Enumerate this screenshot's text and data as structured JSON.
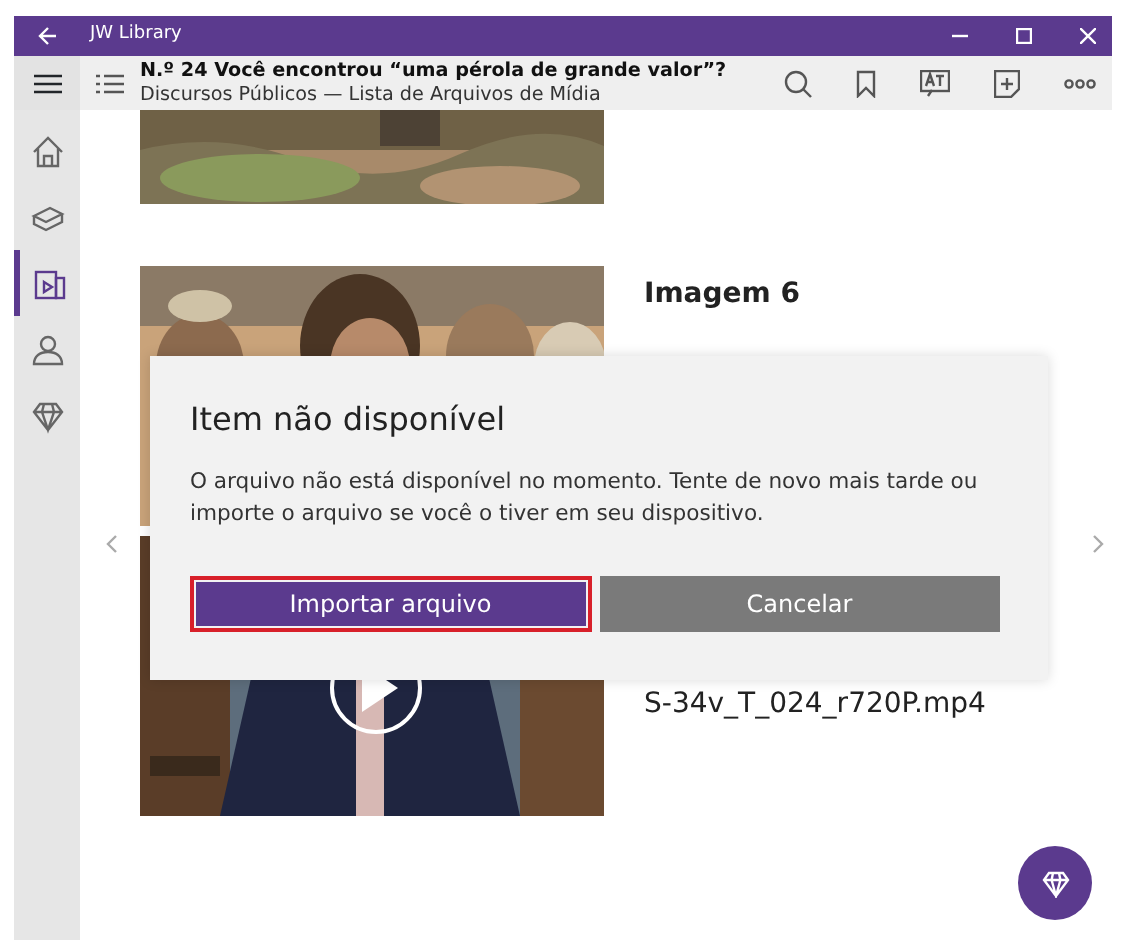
{
  "window": {
    "title": "JW Library"
  },
  "header": {
    "title": "N.º 24 Você encontrou “uma pérola de grande valor”?",
    "subtitle": "Discursos Públicos — Lista de Arquivos de Mídia"
  },
  "sidebar": {
    "items": [
      {
        "kind": "home",
        "selected": false
      },
      {
        "kind": "book",
        "selected": false
      },
      {
        "kind": "media",
        "selected": true
      },
      {
        "kind": "person",
        "selected": false
      },
      {
        "kind": "gem",
        "selected": false
      }
    ]
  },
  "media": [
    {
      "kind": "picture"
    },
    {
      "kind": "picture",
      "title": "Imagem 6"
    },
    {
      "kind": "video",
      "filename": "S-34v_T_024_r720P.mp4"
    }
  ],
  "dialog": {
    "title": "Item não disponível",
    "message": "O arquivo não está disponível no momento. Tente de novo mais tarde ou importe o arquivo se você o tiver em seu dispositivo.",
    "buttons": [
      {
        "label": "Importar arquivo",
        "kind": "primary",
        "focused": true
      },
      {
        "label": "Cancelar",
        "kind": "secondary",
        "focused": false
      }
    ]
  }
}
